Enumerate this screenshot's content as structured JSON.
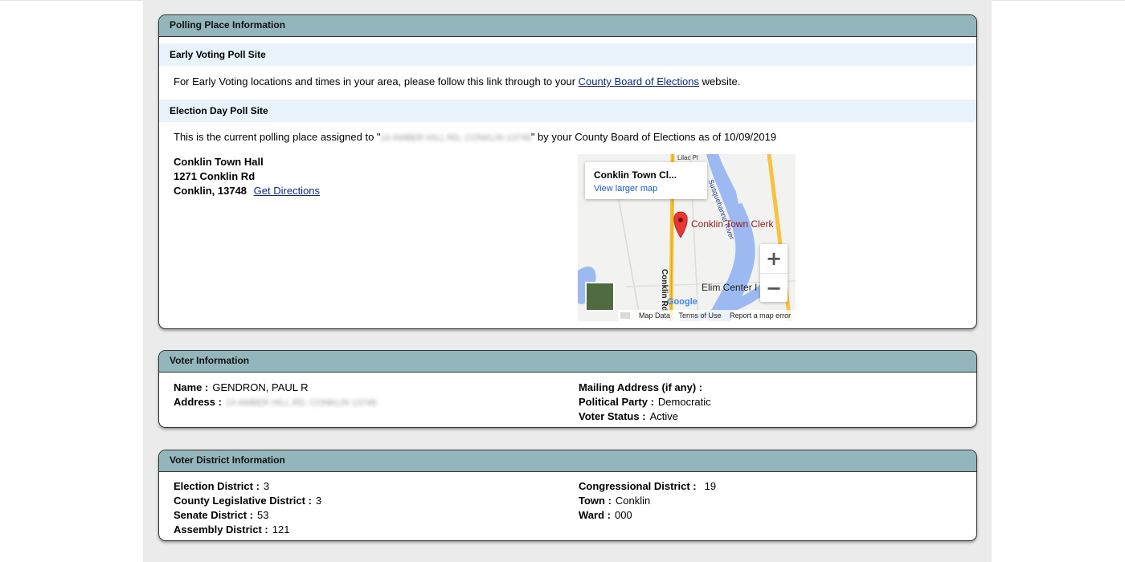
{
  "polling": {
    "header": "Polling Place Information",
    "early_title": "Early Voting Poll Site",
    "early_text_before": "For Early Voting locations and times in your area, please follow this link through to your",
    "early_link": "County Board of Elections",
    "early_text_after": "website.",
    "election_day_title": "Election Day Poll Site",
    "assigned_text_before": "This is the current polling place assigned to \"",
    "assigned_address_blurred": "14 AMBER HILL RD, CONKLIN 13748",
    "assigned_text_after": "\" by your County Board of Elections as of 10/09/2019",
    "site_name": "Conklin Town Hall",
    "site_street": "1271 Conklin Rd",
    "site_city": "Conklin, 13748",
    "directions_link": "Get Directions"
  },
  "map": {
    "place_title": "Conklin Town Cl...",
    "larger_map": "View larger map",
    "marker_label": "Conklin Town Clerk",
    "label_lilac": "Lilac Pl",
    "label_river": "Susquehanna River",
    "label_road": "Conklin Rd",
    "label_elim": "Elim Center I",
    "google": "Google",
    "map_data": "Map Data",
    "terms": "Terms of Use",
    "report": "Report a map error",
    "zoom_in": "+",
    "zoom_out": "−",
    "colors": {
      "water": "#9cb9f2",
      "road": "#f6c343",
      "marker": "#e53935"
    }
  },
  "voter": {
    "header": "Voter Information",
    "name_label": "Name :",
    "name_value": "GENDRON, PAUL R",
    "address_label": "Address :",
    "address_value_blurred": "14 AMBER HILL RD, CONKLIN 13748",
    "mailing_label": "Mailing Address (if any) :",
    "party_label": "Political Party :",
    "party_value": "Democratic",
    "status_label": "Voter Status :",
    "status_value": "Active"
  },
  "district": {
    "header": "Voter District Information",
    "election_label": "Election District :",
    "election_value": "3",
    "county_label": "County Legislative District :",
    "county_value": "3",
    "senate_label": "Senate District :",
    "senate_value": "53",
    "assembly_label": "Assembly District :",
    "assembly_value": "121",
    "congress_label": "Congressional District :",
    "congress_value": "19",
    "town_label": "Town :",
    "town_value": "Conklin",
    "ward_label": "Ward :",
    "ward_value": "000"
  }
}
